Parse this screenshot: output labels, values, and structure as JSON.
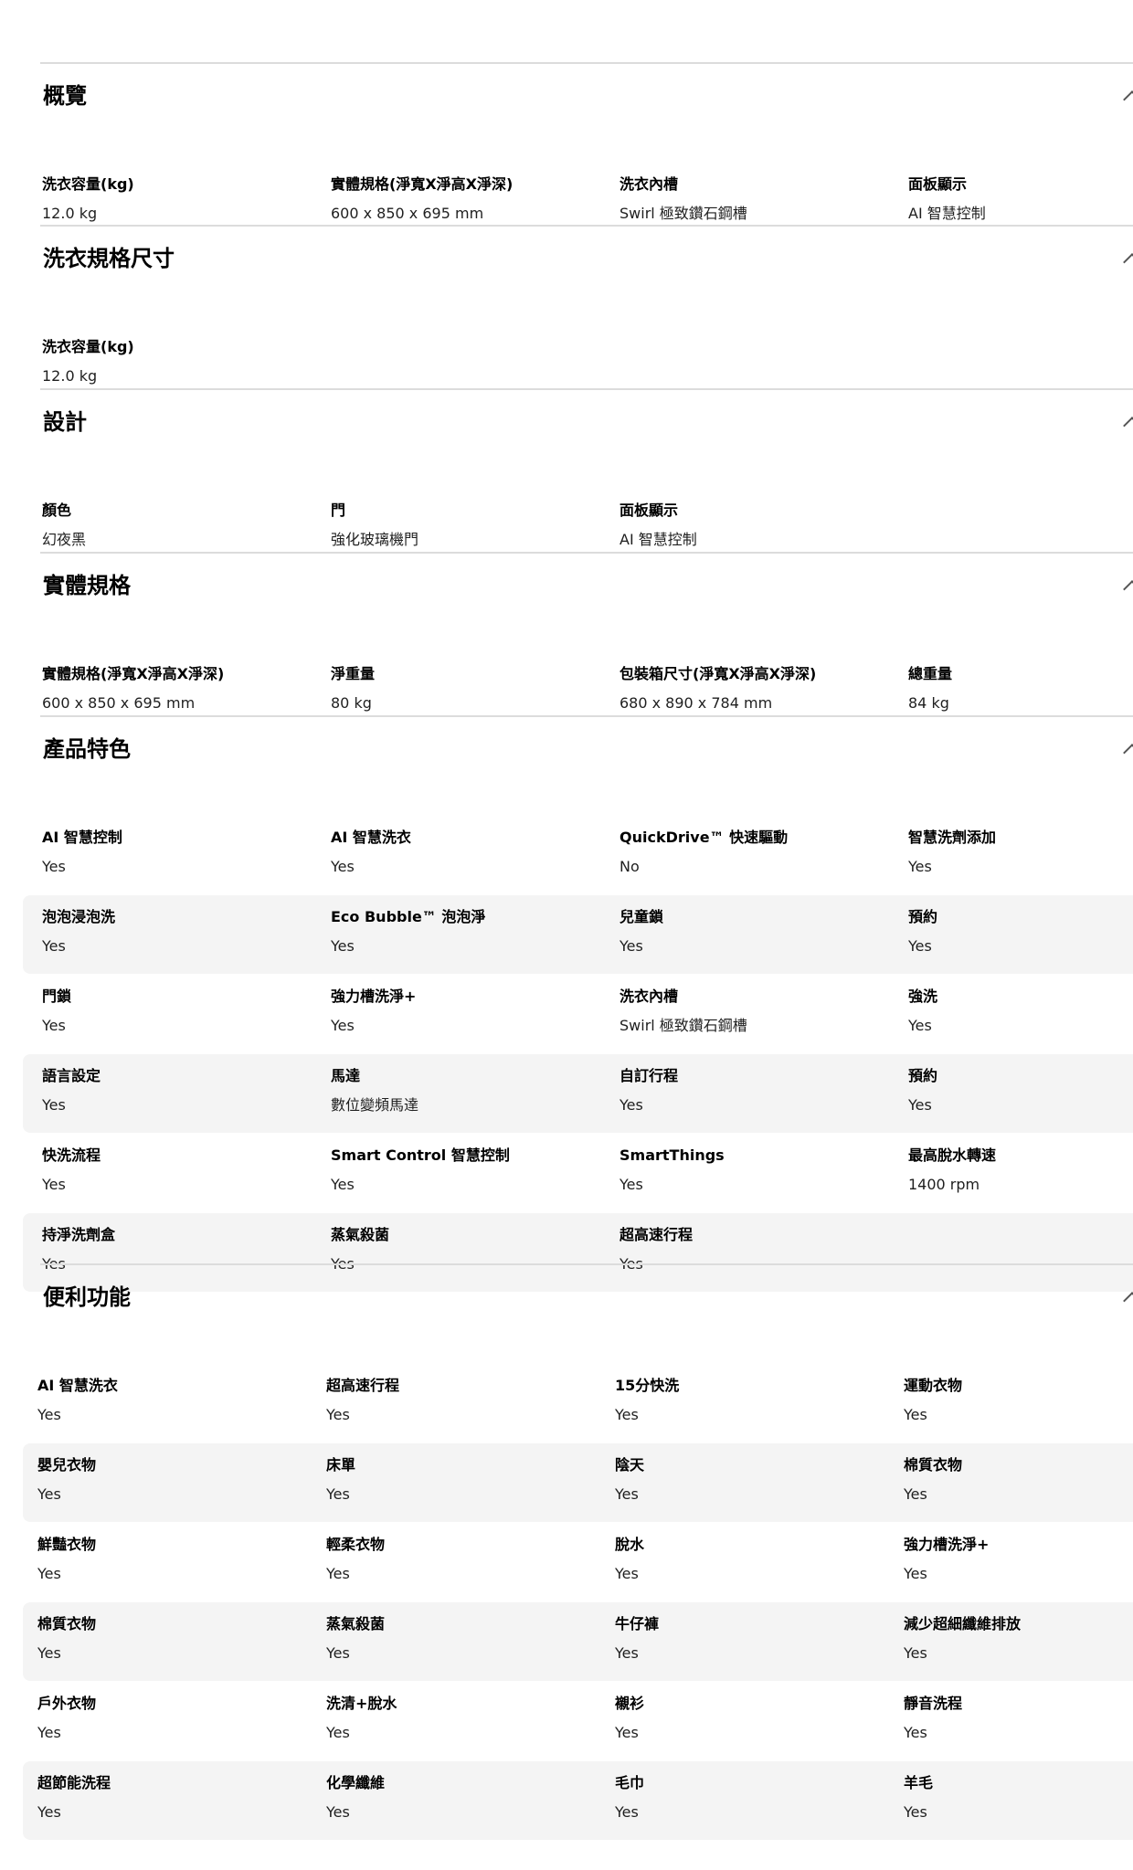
{
  "sections": [
    {
      "title": "概覽",
      "rows": [
        [
          {
            "label": "洗衣容量(kg)",
            "value": "12.0 kg"
          },
          {
            "label": "實體規格(淨寬X淨高X淨深)",
            "value": "600 x 850 x 695 mm"
          },
          {
            "label": "洗衣內槽",
            "value": "Swirl 極致鑽石鋼槽"
          },
          {
            "label": "面板顯示",
            "value": "AI 智慧控制"
          }
        ]
      ]
    },
    {
      "title": "洗衣規格尺寸",
      "rows": [
        [
          {
            "label": "洗衣容量(kg)",
            "value": "12.0 kg"
          }
        ]
      ]
    },
    {
      "title": "設計",
      "rows": [
        [
          {
            "label": "顏色",
            "value": "幻夜黑"
          },
          {
            "label": "門",
            "value": "強化玻璃機門"
          },
          {
            "label": "面板顯示",
            "value": "AI 智慧控制"
          }
        ]
      ]
    },
    {
      "title": "實體規格",
      "rows": [
        [
          {
            "label": "實體規格(淨寬X淨高X淨深)",
            "value": "600 x 850 x 695 mm"
          },
          {
            "label": "淨重量",
            "value": "80 kg"
          },
          {
            "label": "包裝箱尺寸(淨寬X淨高X淨深)",
            "value": "680 x 890 x 784 mm"
          },
          {
            "label": "總重量",
            "value": "84 kg"
          }
        ]
      ]
    },
    {
      "title": "產品特色",
      "rows": [
        [
          {
            "label": "AI 智慧控制",
            "value": "Yes"
          },
          {
            "label": "AI 智慧洗衣",
            "value": "Yes"
          },
          {
            "label": "QuickDrive™ 快速驅動",
            "value": "No"
          },
          {
            "label": "智慧洗劑添加",
            "value": "Yes"
          }
        ],
        [
          {
            "label": "泡泡浸泡洗",
            "value": "Yes"
          },
          {
            "label": "Eco Bubble™ 泡泡淨",
            "value": "Yes"
          },
          {
            "label": "兒童鎖",
            "value": "Yes"
          },
          {
            "label": "預約",
            "value": "Yes"
          }
        ],
        [
          {
            "label": "門鎖",
            "value": "Yes"
          },
          {
            "label": "強力槽洗淨+",
            "value": "Yes"
          },
          {
            "label": "洗衣內槽",
            "value": "Swirl 極致鑽石鋼槽"
          },
          {
            "label": "強洗",
            "value": "Yes"
          }
        ],
        [
          {
            "label": "語言設定",
            "value": "Yes"
          },
          {
            "label": "馬達",
            "value": "數位變頻馬達"
          },
          {
            "label": "自訂行程",
            "value": "Yes"
          },
          {
            "label": "預約",
            "value": "Yes"
          }
        ],
        [
          {
            "label": "快洗流程",
            "value": "Yes"
          },
          {
            "label": "Smart Control 智慧控制",
            "value": "Yes"
          },
          {
            "label": "SmartThings",
            "value": "Yes"
          },
          {
            "label": "最高脫水轉速",
            "value": "1400 rpm"
          }
        ],
        [
          {
            "label": "持淨洗劑盒",
            "value": "Yes"
          },
          {
            "label": "蒸氣殺菌",
            "value": "Yes"
          },
          {
            "label": "超高速行程",
            "value": "Yes"
          }
        ]
      ]
    },
    {
      "title": "便利功能",
      "rows": [
        [
          {
            "label": "AI 智慧洗衣",
            "value": "Yes"
          },
          {
            "label": "超高速行程",
            "value": "Yes"
          },
          {
            "label": "15分快洗",
            "value": "Yes"
          },
          {
            "label": "運動衣物",
            "value": "Yes"
          }
        ],
        [
          {
            "label": "嬰兒衣物",
            "value": "Yes"
          },
          {
            "label": "床單",
            "value": "Yes"
          },
          {
            "label": "陰天",
            "value": "Yes"
          },
          {
            "label": "棉質衣物",
            "value": "Yes"
          }
        ],
        [
          {
            "label": "鮮豔衣物",
            "value": "Yes"
          },
          {
            "label": "輕柔衣物",
            "value": "Yes"
          },
          {
            "label": "脫水",
            "value": "Yes"
          },
          {
            "label": "強力槽洗淨+",
            "value": "Yes"
          }
        ],
        [
          {
            "label": "棉質衣物",
            "value": "Yes"
          },
          {
            "label": "蒸氣殺菌",
            "value": "Yes"
          },
          {
            "label": "牛仔褲",
            "value": "Yes"
          },
          {
            "label": "減少超細纖維排放",
            "value": "Yes"
          }
        ],
        [
          {
            "label": "戶外衣物",
            "value": "Yes"
          },
          {
            "label": "洗清+脫水",
            "value": "Yes"
          },
          {
            "label": "襯衫",
            "value": "Yes"
          },
          {
            "label": "靜音洗程",
            "value": "Yes"
          }
        ],
        [
          {
            "label": "超節能洗程",
            "value": "Yes"
          },
          {
            "label": "化學纖維",
            "value": "Yes"
          },
          {
            "label": "毛巾",
            "value": "Yes"
          },
          {
            "label": "羊毛",
            "value": "Yes"
          }
        ]
      ]
    }
  ]
}
